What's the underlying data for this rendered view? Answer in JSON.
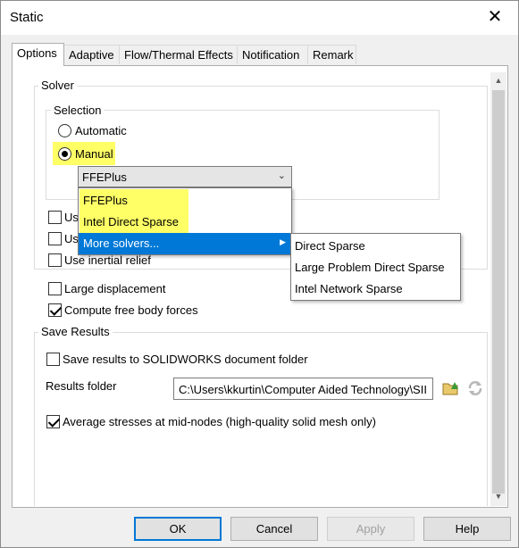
{
  "window": {
    "title": "Static",
    "close_glyph": "✕"
  },
  "tabs": [
    {
      "label": "Options",
      "active": true
    },
    {
      "label": "Adaptive"
    },
    {
      "label": "Flow/Thermal Effects"
    },
    {
      "label": "Notification"
    },
    {
      "label": "Remark"
    }
  ],
  "solver": {
    "group_label": "Solver",
    "selection_label": "Selection",
    "automatic_label": "Automatic",
    "manual_label": "Manual",
    "selected_mode": "Manual",
    "combo_value": "FFEPlus",
    "dropdown_items": [
      "FFEPlus",
      "Intel Direct Sparse",
      "More solvers..."
    ],
    "submenu_items": [
      "Direct Sparse",
      "Large Problem Direct Sparse",
      "Intel Network Sparse"
    ],
    "highlight_color": "#ffff66",
    "selection_color": "#0078d7"
  },
  "options": {
    "partial_1": "Us",
    "partial_2": "Us",
    "inertial_relief": "Use inertial relief",
    "large_displacement": "Large displacement",
    "compute_free_body": "Compute free body forces"
  },
  "save_results": {
    "group_label": "Save Results",
    "save_to_doc_folder": "Save results to SOLIDWORKS document folder",
    "results_folder_label": "Results folder",
    "results_folder_value": "C:\\Users\\kkurtin\\Computer Aided Technology\\SII",
    "average_stresses": "Average stresses at mid-nodes (high-quality solid mesh only)"
  },
  "buttons": {
    "ok": "OK",
    "cancel": "Cancel",
    "apply": "Apply",
    "help": "Help"
  }
}
